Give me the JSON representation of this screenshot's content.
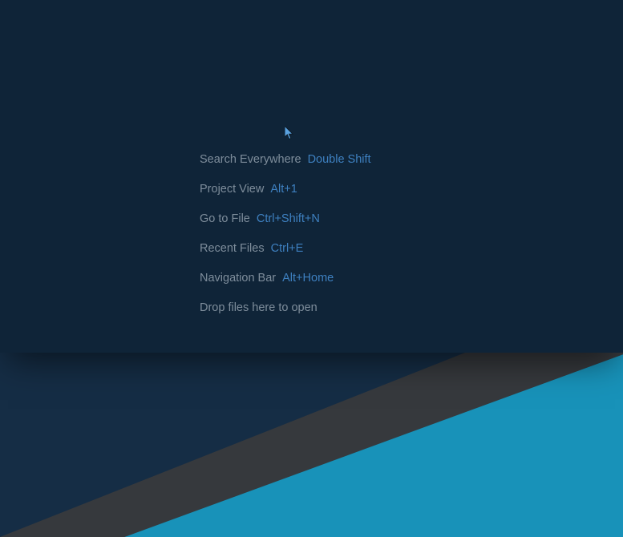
{
  "hints": [
    {
      "label": "Search Everywhere",
      "shortcut": "Double Shift"
    },
    {
      "label": "Project View",
      "shortcut": "Alt+1"
    },
    {
      "label": "Go to File",
      "shortcut": "Ctrl+Shift+N"
    },
    {
      "label": "Recent Files",
      "shortcut": "Ctrl+E"
    },
    {
      "label": "Navigation Bar",
      "shortcut": "Alt+Home"
    }
  ],
  "dropHint": "Drop files here to open"
}
